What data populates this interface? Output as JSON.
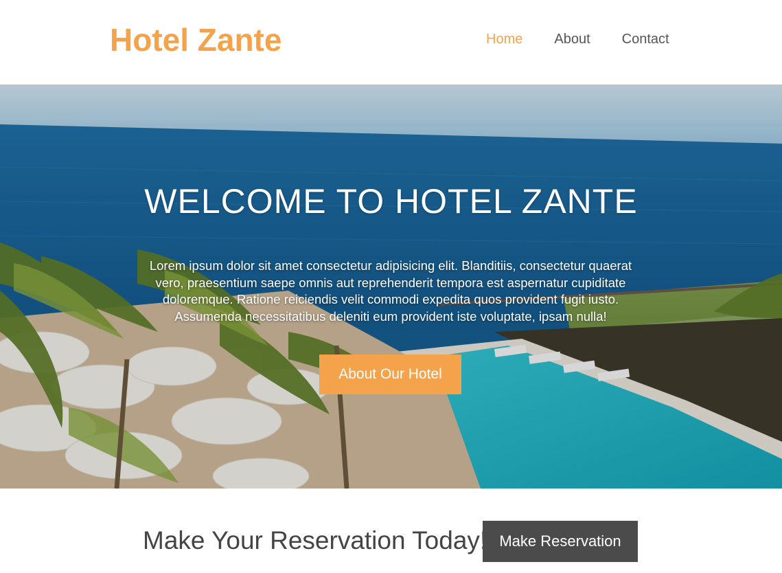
{
  "header": {
    "brand": "Hotel Zante",
    "nav": [
      {
        "label": "Home",
        "active": true
      },
      {
        "label": "About",
        "active": false
      },
      {
        "label": "Contact",
        "active": false
      }
    ]
  },
  "hero": {
    "title": "WELCOME TO HOTEL ZANTE",
    "text": "Lorem ipsum dolor sit amet consectetur adipisicing elit. Blanditiis, consectetur quaerat vero, praesentium saepe omnis aut reprehenderit tempora est aspernatur cupiditate doloremque. Ratione reiciendis velit commodi expedita quos provident fugit iusto. Assumenda necessitatibus deleniti eum provident iste voluptate, ipsam nulla!",
    "button_label": "About Our Hotel",
    "image": "ocean-resort-pool-photo"
  },
  "reservation": {
    "text": "Make Your Reservation Today!",
    "button_label": "Make Reservation"
  },
  "colors": {
    "accent": "#f5a34a",
    "nav_text": "#555555",
    "dark_button": "#4b4b4b"
  }
}
